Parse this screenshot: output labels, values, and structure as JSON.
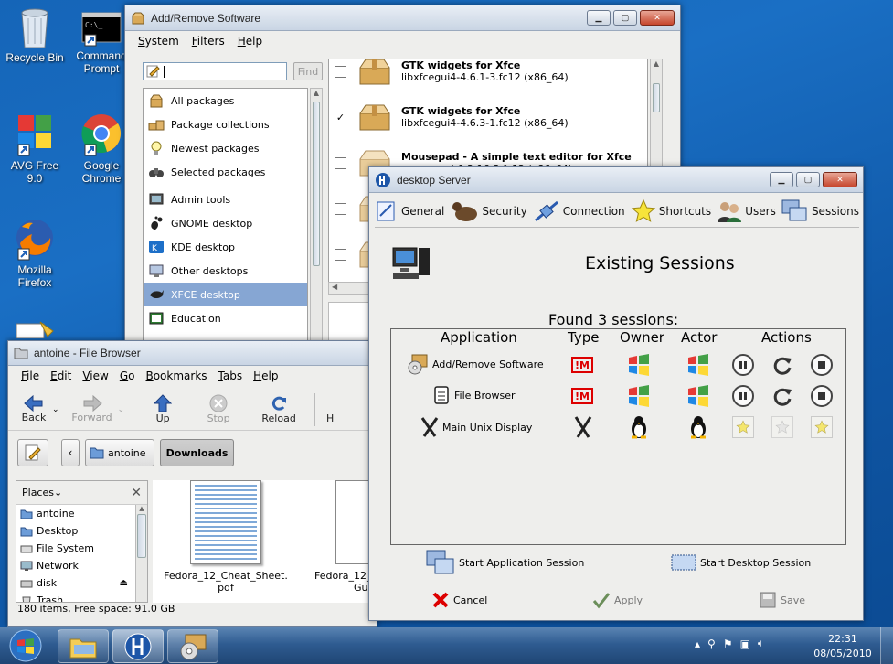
{
  "desktop": {
    "icons": [
      {
        "label1": "Recycle Bin",
        "label2": ""
      },
      {
        "label1": "Command",
        "label2": "Prompt"
      },
      {
        "label1": "AVG Free 9.0",
        "label2": ""
      },
      {
        "label1": "Google",
        "label2": "Chrome"
      },
      {
        "label1": "Mozilla",
        "label2": "Firefox"
      }
    ]
  },
  "software": {
    "title": "Add/Remove Software",
    "menu": [
      "System",
      "Filters",
      "Help"
    ],
    "search_value": "",
    "find_label": "Find",
    "categories": [
      {
        "label": "All packages",
        "icon": "package-icon"
      },
      {
        "label": "Package collections",
        "icon": "collection-icon"
      },
      {
        "label": "Newest packages",
        "icon": "lightbulb-icon"
      },
      {
        "label": "Selected packages",
        "icon": "binoculars-icon"
      },
      {
        "label": "Admin tools",
        "icon": "admin-icon"
      },
      {
        "label": "GNOME desktop",
        "icon": "gnome-icon"
      },
      {
        "label": "KDE desktop",
        "icon": "kde-icon"
      },
      {
        "label": "Other desktops",
        "icon": "desktop-icon"
      },
      {
        "label": "XFCE desktop",
        "icon": "xfce-icon"
      },
      {
        "label": "Education",
        "icon": "education-icon"
      }
    ],
    "selected_category": "XFCE desktop",
    "packages": [
      {
        "name": "GTK widgets for Xfce",
        "version": "libxfcegui4-4.6.1-3.fc12 (x86_64)",
        "checked": false
      },
      {
        "name": "GTK widgets for Xfce",
        "version": "libxfcegui4-4.6.3-1.fc12 (x86_64)",
        "checked": true
      },
      {
        "name": "Mousepad - A simple text editor for Xfce",
        "version": "mousepad-0.2.16-3.fc12 (x86_64)",
        "checked": false
      }
    ]
  },
  "browser": {
    "title": "antoine - File Browser",
    "menu": [
      "File",
      "Edit",
      "View",
      "Go",
      "Bookmarks",
      "Tabs",
      "Help"
    ],
    "toolbar": {
      "back": "Back",
      "forward": "Forward",
      "up": "Up",
      "stop": "Stop",
      "reload": "Reload",
      "home": "H"
    },
    "path": [
      "antoine",
      "Downloads"
    ],
    "places_label": "Places",
    "places": [
      {
        "label": "antoine",
        "icon": "home-icon"
      },
      {
        "label": "Desktop",
        "icon": "desktop-icon"
      },
      {
        "label": "File System",
        "icon": "drive-icon"
      },
      {
        "label": "Network",
        "icon": "network-icon"
      },
      {
        "label": "disk",
        "icon": "disk-icon"
      },
      {
        "label": "Trash",
        "icon": "trash-icon"
      }
    ],
    "files": [
      {
        "line1": "Fedora_12_Cheat_Sheet.",
        "line2": "pdf"
      },
      {
        "line1": "Fedora_12_",
        "line2": "Guid"
      }
    ],
    "status": "180 items, Free space: 91.0 GB"
  },
  "server": {
    "title": "desktop Server",
    "tabs": [
      "General",
      "Security",
      "Connection",
      "Shortcuts",
      "Users",
      "Sessions"
    ],
    "heading": "Existing Sessions",
    "found": "Found 3 sessions:",
    "columns": [
      "Application",
      "Type",
      "Owner",
      "Actor",
      "Actions"
    ],
    "sessions": [
      {
        "app": "Add/Remove Software",
        "type": "X-window",
        "owner": "windows",
        "actor": "windows",
        "actions_enabled": true
      },
      {
        "app": "File Browser",
        "type": "X-window",
        "owner": "windows",
        "actor": "windows",
        "actions_enabled": true
      },
      {
        "app": "Main Unix Display",
        "type": "X",
        "owner": "tux",
        "actor": "tux",
        "actions_enabled": false
      }
    ],
    "start_app": "Start Application Session",
    "start_desktop": "Start Desktop Session",
    "cancel": "Cancel",
    "apply": "Apply",
    "save": "Save"
  },
  "taskbar": {
    "time": "22:31",
    "date": "08/05/2010"
  }
}
